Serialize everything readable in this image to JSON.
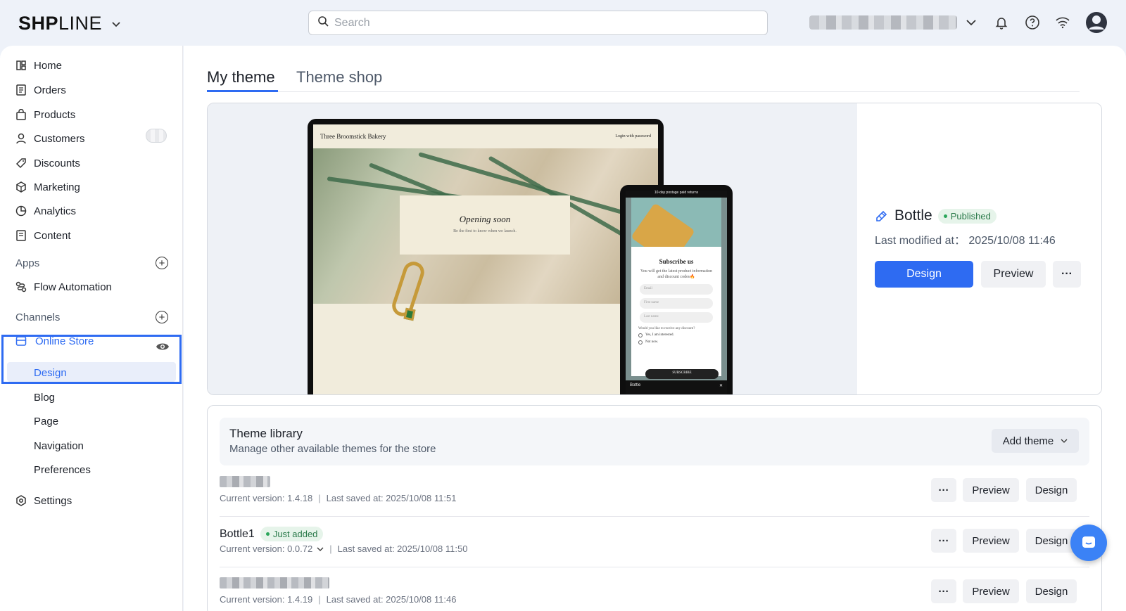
{
  "header": {
    "logo_bold": "SH",
    "logo_mid": "P",
    "logo_light": "LINE",
    "search_placeholder": "Search",
    "icons": [
      "bell-icon",
      "help-icon",
      "wifi-icon",
      "user-avatar-icon"
    ]
  },
  "sidebar": {
    "items": [
      {
        "label": "Home",
        "icon": "home-icon"
      },
      {
        "label": "Orders",
        "icon": "orders-icon"
      },
      {
        "label": "Products",
        "icon": "products-icon"
      },
      {
        "label": "Customers",
        "icon": "customers-icon"
      },
      {
        "label": "Discounts",
        "icon": "discounts-icon"
      },
      {
        "label": "Marketing",
        "icon": "marketing-icon"
      },
      {
        "label": "Analytics",
        "icon": "analytics-icon"
      },
      {
        "label": "Content",
        "icon": "content-icon"
      }
    ],
    "apps_title": "Apps",
    "apps_items": [
      {
        "label": "Flow Automation",
        "icon": "flow-icon"
      }
    ],
    "channels_title": "Channels",
    "online_store": "Online Store",
    "online_store_sub": [
      "Design",
      "Blog",
      "Page",
      "Navigation",
      "Preferences"
    ],
    "settings": "Settings"
  },
  "main": {
    "tabs": [
      "My theme",
      "Theme shop"
    ],
    "current_theme": {
      "name": "Bottle",
      "status": "Published",
      "last_modified": "Last modified at： 2025/10/08 11:46",
      "design_label": "Design",
      "preview_label": "Preview",
      "more_label": "···",
      "preview_site": {
        "store_name": "Three Broomstick Bakery",
        "login_text": "Login with password",
        "opening": "Opening soon",
        "opening_sub": "Be the first to know when we launch.",
        "phone_banner": "10-day postage paid returns",
        "subscribe_title": "Subscribe us",
        "subscribe_desc": "You will get the latest product information and discount codes🔥",
        "fields": [
          "Email",
          "First name",
          "Last name"
        ],
        "question": "Would you like to receive any discount?",
        "options": [
          "Yes, I am interested.",
          "Not now."
        ],
        "subscribe_btn": "SUBSCRIBE",
        "phone_footer": "Bottle"
      }
    },
    "library": {
      "title": "Theme library",
      "subtitle": "Manage other available themes for the store",
      "add_label": "Add theme",
      "rows": [
        {
          "name": "",
          "badge": "",
          "version": "Current version: 1.4.18",
          "saved": "Last saved at: 2025/10/08 11:51"
        },
        {
          "name": "Bottle1",
          "badge": "Just added",
          "version": "Current version: 0.0.72",
          "saved": "Last saved at: 2025/10/08 11:50"
        },
        {
          "name": "",
          "badge": "",
          "version": "Current version: 1.4.19",
          "saved": "Last saved at: 2025/10/08 11:46"
        }
      ],
      "more_label": "···",
      "preview_label": "Preview",
      "design_label": "Design"
    }
  },
  "colors": {
    "accent": "#2e6bf2",
    "published_green": "#2aa65a",
    "bg": "#eef2f9"
  }
}
